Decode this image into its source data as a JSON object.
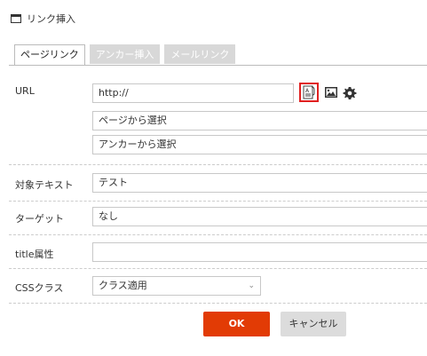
{
  "dialog": {
    "title": "リンク挿入"
  },
  "tabs": [
    {
      "label": "ページリンク",
      "active": true
    },
    {
      "label": "アンカー挿入",
      "active": false
    },
    {
      "label": "メールリンク",
      "active": false
    }
  ],
  "url": {
    "label": "URL",
    "value": "http://",
    "select_page_label": "ページから選択",
    "select_anchor_label": "アンカーから選択",
    "icons": [
      "cms-link-icon",
      "image-icon",
      "gear-icon"
    ]
  },
  "target_text": {
    "label": "対象テキスト",
    "value": "テスト"
  },
  "target": {
    "label": "ターゲット",
    "value": "なし"
  },
  "title_attr": {
    "label": "title属性",
    "value": ""
  },
  "css_class": {
    "label": "CSSクラス",
    "value": "クラス適用"
  },
  "buttons": {
    "ok": "OK",
    "cancel": "キャンセル"
  },
  "colors": {
    "ok_bg": "#e23b05",
    "highlight_border": "#e02020",
    "tab_inactive_bg": "#d8d8d8"
  }
}
